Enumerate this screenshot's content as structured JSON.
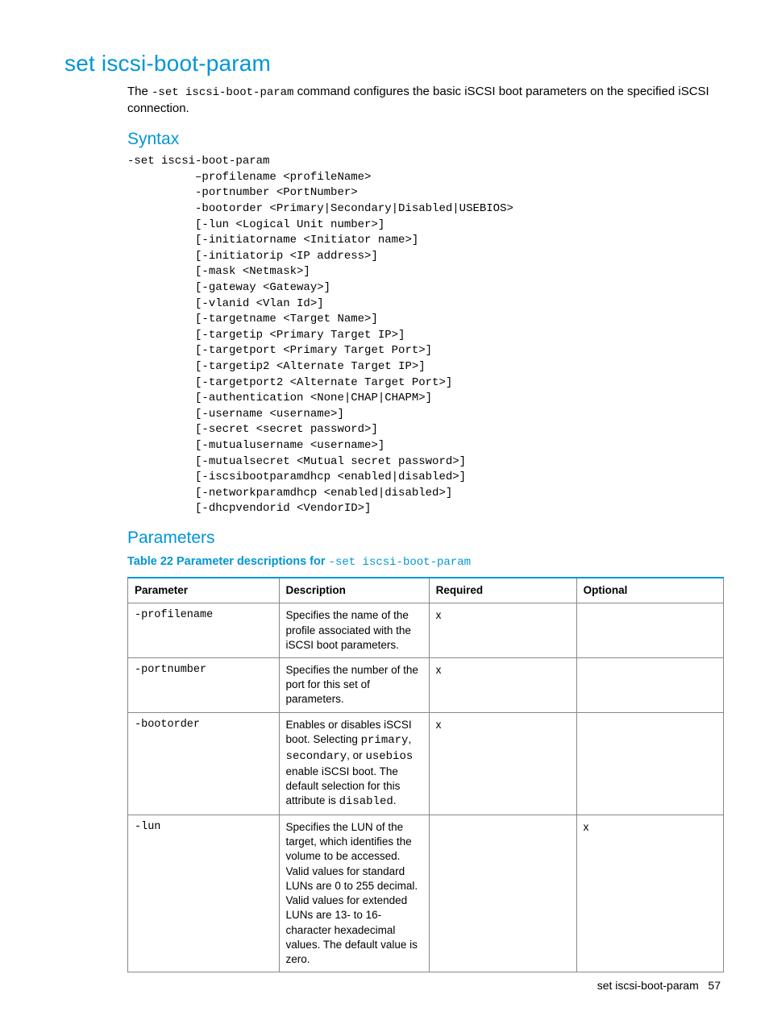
{
  "title": "set iscsi-boot-param",
  "intro_pre": "The ",
  "intro_code": "-set iscsi-boot-param",
  "intro_post": " command configures the basic iSCSI boot parameters on the specified iSCSI connection.",
  "sections": {
    "syntax_heading": "Syntax",
    "parameters_heading": "Parameters"
  },
  "syntax_text": "-set iscsi-boot-param\n          –profilename <profileName>\n          -portnumber <PortNumber>\n          -bootorder <Primary|Secondary|Disabled|USEBIOS>\n          [-lun <Logical Unit number>]\n          [-initiatorname <Initiator name>]\n          [-initiatorip <IP address>]\n          [-mask <Netmask>]\n          [-gateway <Gateway>]\n          [-vlanid <Vlan Id>]\n          [-targetname <Target Name>]\n          [-targetip <Primary Target IP>]\n          [-targetport <Primary Target Port>]\n          [-targetip2 <Alternate Target IP>]\n          [-targetport2 <Alternate Target Port>]\n          [-authentication <None|CHAP|CHAPM>]\n          [-username <username>]\n          [-secret <secret password>]\n          [-mutualusername <username>]\n          [-mutualsecret <Mutual secret password>]\n          [-iscsibootparamdhcp <enabled|disabled>]\n          [-networkparamdhcp <enabled|disabled>]\n          [-dhcpvendorid <VendorID>]",
  "table_caption_pre": "Table 22 Parameter descriptions for ",
  "table_caption_code": "-set iscsi-boot-param",
  "table": {
    "headers": {
      "parameter": "Parameter",
      "description": "Description",
      "required": "Required",
      "optional": "Optional"
    },
    "rows": [
      {
        "parameter": "-profilename",
        "description_html": "Specifies the name of the profile associated with the iSCSI boot parameters.",
        "required": "x",
        "optional": ""
      },
      {
        "parameter": "-portnumber",
        "description_html": "Specifies the number of the port for this set of parameters.",
        "required": "x",
        "optional": ""
      },
      {
        "parameter": "-bootorder",
        "description_html": "Enables or disables iSCSI boot. Selecting <span class=\"mono\">primary</span>, <span class=\"mono\">secondary</span>, or <span class=\"mono\">usebios</span> enable iSCSI boot. The default selection for this attribute is <span class=\"mono\">disabled</span>.",
        "required": "x",
        "optional": ""
      },
      {
        "parameter": "-lun",
        "description_html": "Specifies the LUN of the target, which identifies the volume to be accessed. Valid values for standard LUNs are 0 to 255 decimal. Valid values for extended LUNs are 13- to 16-character hexadecimal values. The default value is zero.",
        "required": "",
        "optional": "x"
      }
    ]
  },
  "footer": {
    "label": "set iscsi-boot-param",
    "page_number": "57"
  }
}
